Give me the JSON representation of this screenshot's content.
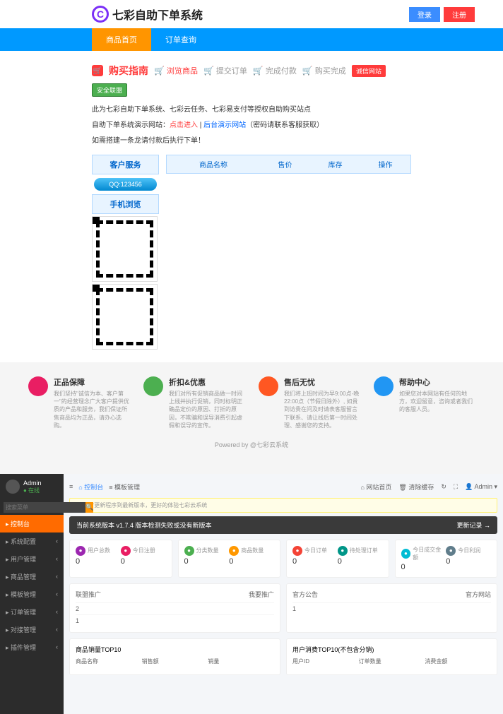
{
  "top": {
    "logo_letter": "C",
    "logo_text": "七彩自助下单系统",
    "login": "登录",
    "register": "注册",
    "nav": {
      "home": "商品首页",
      "orders": "订单查询"
    },
    "guide": {
      "title": "购买指南",
      "steps": [
        "浏览商品",
        "提交订单",
        "完成付款",
        "购买完成"
      ],
      "badge1": "诚信网站",
      "badge2": "安全联盟"
    },
    "notice1_a": "此为七彩自助下单系统、七彩云任务、七彩易支付等授权自助购买站点",
    "notice2_a": "自助下单系统演示网站：",
    "notice2_b": "点击进入",
    "notice2_c": " | ",
    "notice2_d": "后台演示网站",
    "notice2_e": "（密码请联系客服获取）",
    "notice3": "如需搭建一条龙请付款后执行下单！",
    "side": {
      "service": "客户服务",
      "qq": "QQ:123456",
      "mobile": "手机浏览"
    },
    "table": {
      "h1": "商品名称",
      "h2": "售价",
      "h3": "库存",
      "h4": "操作"
    },
    "info": [
      {
        "title": "正品保障",
        "desc": "我们坚持\"诚信为本、客户第一\"的经营理念广大客户提供优质的产品和服务，我们保证所售商品均为正品，请办心选购。",
        "color": "#e91e63"
      },
      {
        "title": "折扣&优惠",
        "desc": "我们对所有促销商品做一时间上线并执行促销，同时标明正确品定价的原因、打折的原因，不欺骗和误导消费引起虚假和误导的宣传。",
        "color": "#4caf50"
      },
      {
        "title": "售后无忧",
        "desc": "我们将上班时间为早9:00点-晚22:00点（节假日除外）, 如贵到访贵在问及时请表客服留言下联系、请让线后第一时间处理、感谢您的支持。",
        "color": "#ff5722"
      },
      {
        "title": "帮助中心",
        "desc": "如果您对本网站有任何的地方，欢迎留意，咨询或者我们的客服人员。",
        "color": "#2196f3"
      }
    ],
    "powered": "Powered by @七彩云系统"
  },
  "admin": {
    "user": "Admin",
    "status": "● 在线",
    "search_ph": "搜索菜单",
    "menu": [
      "控制台",
      "系统配置",
      "用户管理",
      "商品管理",
      "模板管理",
      "订单管理",
      "对接管理",
      "插件管理"
    ],
    "breadcrumb": {
      "home": "控制台",
      "page": "模板管理"
    },
    "topbar": {
      "site": "网站首页",
      "cache": "清除缓存",
      "user": "Admin"
    },
    "alert": "及时更新程序到最新版本，更好的体验七彩云系统",
    "version": {
      "text": "当前系统版本 v1.7.4  版本检测失败或没有新版本",
      "link": "更新记录 →"
    },
    "stats": [
      [
        {
          "label": "用户总数",
          "val": "0",
          "color": "#9c27b0"
        },
        {
          "label": "今日注册",
          "val": "0",
          "color": "#e91e63"
        }
      ],
      [
        {
          "label": "分类数量",
          "val": "0",
          "color": "#4caf50"
        },
        {
          "label": "商品数量",
          "val": "0",
          "color": "#ff9800"
        }
      ],
      [
        {
          "label": "今日订单",
          "val": "0",
          "color": "#f44336"
        },
        {
          "label": "待处理订单",
          "val": "0",
          "color": "#009688"
        }
      ],
      [
        {
          "label": "今日成交金额",
          "val": "0",
          "color": "#00bcd4"
        },
        {
          "label": "今日利润",
          "val": "0",
          "color": "#607d8b"
        }
      ]
    ],
    "panels": [
      {
        "title": "联盟推广",
        "right": "我要推广",
        "rows": [
          "2",
          "1"
        ]
      },
      {
        "title": "官方公告",
        "right": "官方网站",
        "rows": [
          "1"
        ]
      }
    ],
    "tables": [
      {
        "title": "商品销量TOP10",
        "cols": [
          "商品名称",
          "销售额",
          "销量"
        ]
      },
      {
        "title": "用户消费TOP10(不包含分销)",
        "cols": [
          "用户ID",
          "订单数量",
          "消费金额"
        ]
      }
    ]
  }
}
